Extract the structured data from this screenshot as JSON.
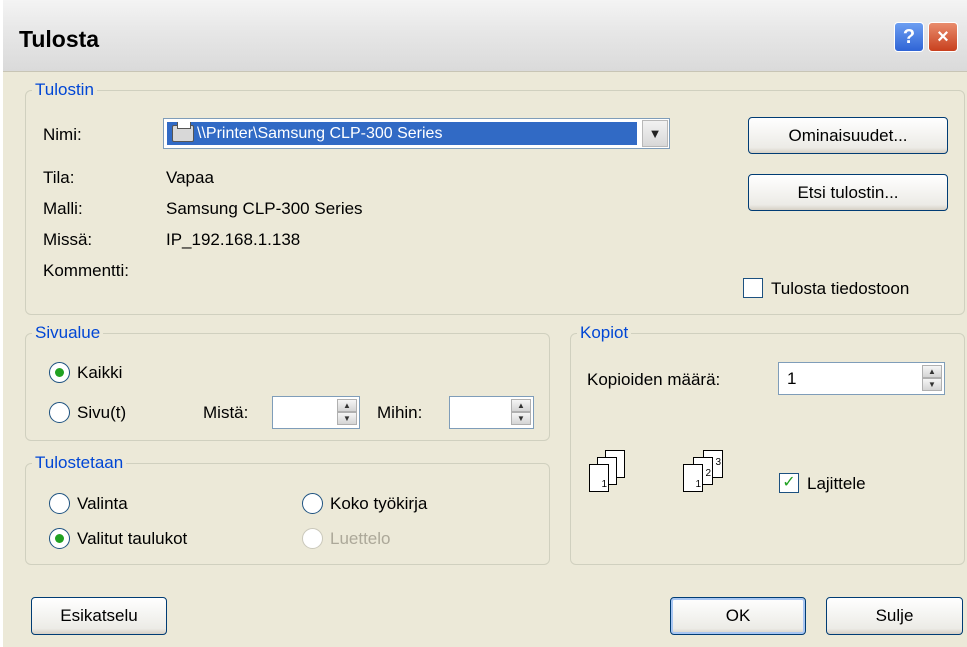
{
  "window": {
    "title": "Tulosta",
    "help_button": "?",
    "close_button": "×"
  },
  "printer_group": {
    "legend": "Tulostin",
    "name_label": "Nimi:",
    "selected_printer": "\\\\Printer\\Samsung CLP-300 Series",
    "properties_button": "Ominaisuudet...",
    "find_printer_button": "Etsi tulostin...",
    "status_label": "Tila:",
    "status_value": "Vapaa",
    "type_label": "Malli:",
    "type_value": "Samsung CLP-300 Series",
    "where_label": "Missä:",
    "where_value": "IP_192.168.1.138",
    "comment_label": "Kommentti:",
    "comment_value": "",
    "print_to_file_label": "Tulosta tiedostoon",
    "print_to_file_checked": false
  },
  "page_range_group": {
    "legend": "Sivualue",
    "all_label": "Kaikki",
    "pages_label": "Sivu(t)",
    "from_label": "Mistä:",
    "to_label": "Mihin:",
    "from_value": "",
    "to_value": "",
    "selected": "all"
  },
  "print_what_group": {
    "legend": "Tulostetaan",
    "selection_label": "Valinta",
    "entire_workbook_label": "Koko työkirja",
    "active_sheets_label": "Valitut taulukot",
    "table_label": "Luettelo",
    "selected": "active_sheets"
  },
  "copies_group": {
    "legend": "Kopiot",
    "copies_label": "Kopioiden määrä:",
    "copies_value": "1",
    "collate_label": "Lajittele",
    "collate_checked": true,
    "page_numbers": [
      "1",
      "2",
      "3"
    ]
  },
  "buttons": {
    "preview": "Esikatselu",
    "ok": "OK",
    "cancel": "Sulje"
  }
}
